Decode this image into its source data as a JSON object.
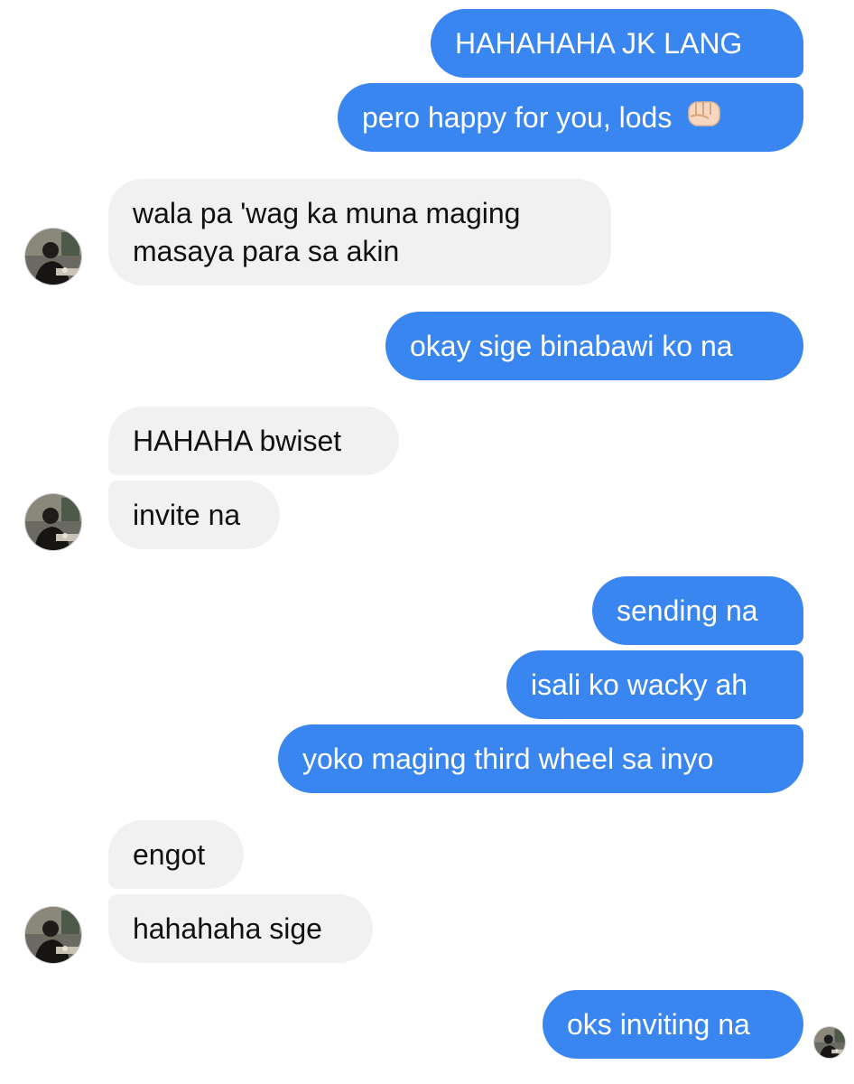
{
  "conversation": {
    "messages": [
      {
        "from": "me",
        "text": "HAHAHAHA JK LANG"
      },
      {
        "from": "me",
        "text": "pero happy for you, lods",
        "emoji": "oncoming-fist-emoji"
      },
      {
        "from": "them",
        "lines": [
          "wala pa 'wag ka muna maging",
          "masaya para sa akin"
        ]
      },
      {
        "from": "me",
        "text": "okay sige binabawi ko na"
      },
      {
        "from": "them",
        "text": "HAHAHA bwiset"
      },
      {
        "from": "them",
        "text": "invite na"
      },
      {
        "from": "me",
        "text": "sending na"
      },
      {
        "from": "me",
        "text": "isali ko wacky ah"
      },
      {
        "from": "me",
        "text": "yoko maging third wheel sa inyo"
      },
      {
        "from": "them",
        "text": "engot"
      },
      {
        "from": "them",
        "text": "hahahaha sige"
      },
      {
        "from": "me",
        "text": "oks inviting na"
      }
    ]
  },
  "colors": {
    "sent_bubble": "#3a86f0",
    "received_bubble": "#f1f1f1",
    "sent_text": "#ffffff",
    "received_text": "#111111"
  }
}
